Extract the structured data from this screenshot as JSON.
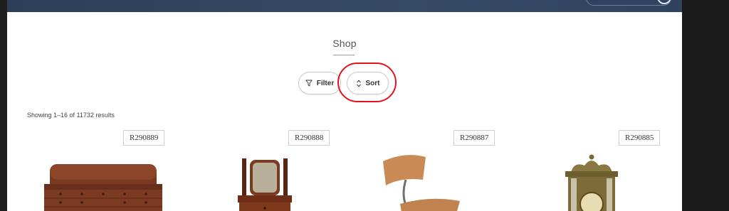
{
  "page": {
    "title": "Shop"
  },
  "controls": {
    "filter_label": "Filter",
    "sort_label": "Sort"
  },
  "results": {
    "summary": "Showing 1–16 of 11732 results"
  },
  "products": [
    {
      "sku": "R290889",
      "image": "roll-top-desk"
    },
    {
      "sku": "R290888",
      "image": "dressing-table-mirror"
    },
    {
      "sku": "R290887",
      "image": "wooden-chair-seat"
    },
    {
      "sku": "R290885",
      "image": "brass-mantel-clock"
    }
  ],
  "colors": {
    "header": "#33475f",
    "highlight": "#e0141e",
    "background": "#ffffff"
  }
}
